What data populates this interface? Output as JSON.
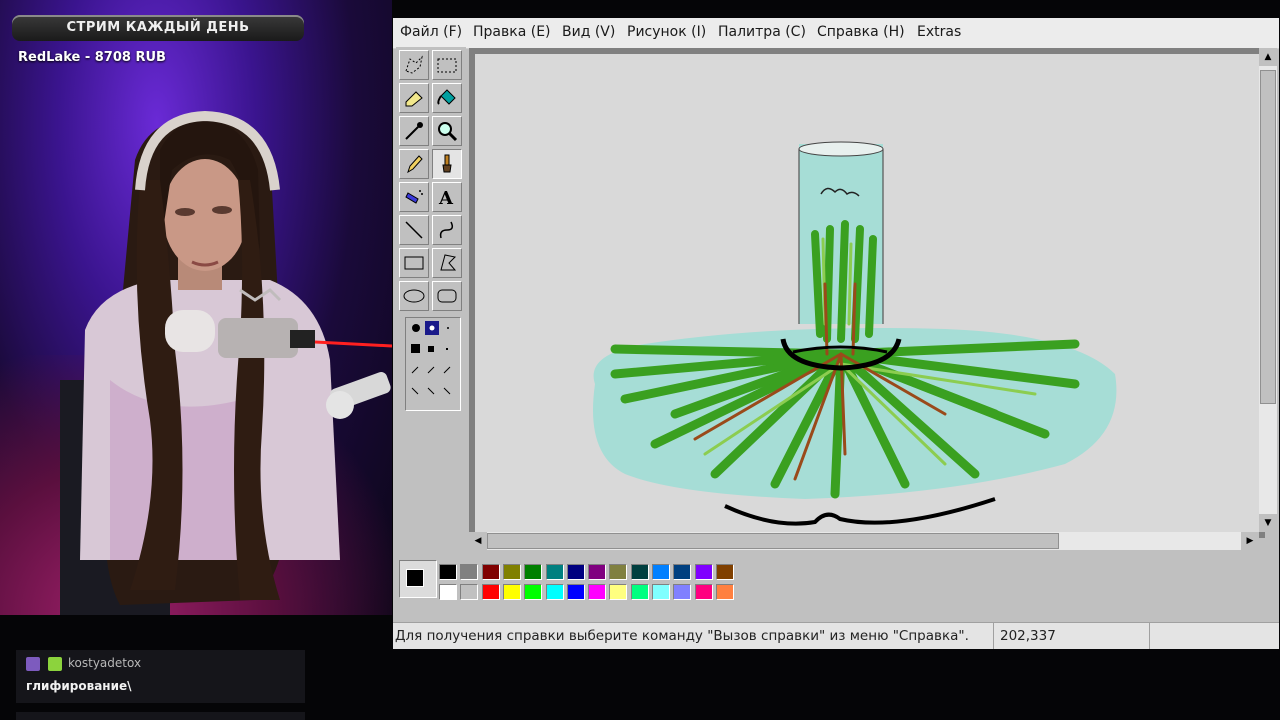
{
  "stream": {
    "alert_banner": "СТРИМ КАЖДЫЙ ДЕНЬ",
    "donation": "RedLake - 8708 RUB"
  },
  "chat": {
    "username": "kostyadetox",
    "message": "глифирование\\"
  },
  "paint": {
    "menu": [
      "Файл (F)",
      "Правка (E)",
      "Вид (V)",
      "Рисунок (I)",
      "Палитра (C)",
      "Справка (H)",
      "Extras"
    ],
    "tools": [
      {
        "name": "free-select-icon"
      },
      {
        "name": "rect-select-icon"
      },
      {
        "name": "eraser-icon"
      },
      {
        "name": "fill-icon"
      },
      {
        "name": "color-picker-icon"
      },
      {
        "name": "magnifier-icon"
      },
      {
        "name": "pencil-icon"
      },
      {
        "name": "brush-icon"
      },
      {
        "name": "airbrush-icon"
      },
      {
        "name": "text-icon",
        "label": "A"
      },
      {
        "name": "line-icon"
      },
      {
        "name": "curve-icon"
      },
      {
        "name": "rectangle-icon"
      },
      {
        "name": "polygon-icon"
      },
      {
        "name": "ellipse-icon"
      },
      {
        "name": "rounded-rect-icon"
      }
    ],
    "selected_tool": "brush-icon",
    "palette_top": [
      "#000000",
      "#808080",
      "#800000",
      "#808000",
      "#008000",
      "#008080",
      "#000080",
      "#800080",
      "#808040",
      "#004040",
      "#0080ff",
      "#004080",
      "#8000ff",
      "#804000"
    ],
    "palette_bottom": [
      "#ffffff",
      "#c0c0c0",
      "#ff0000",
      "#ffff00",
      "#00ff00",
      "#00ffff",
      "#0000ff",
      "#ff00ff",
      "#ffff80",
      "#00ff80",
      "#80ffff",
      "#8080ff",
      "#ff0080",
      "#ff8040"
    ],
    "foreground_color": "#000000",
    "background_color": "#ffffff",
    "status_text": "Для получения справки выберите команду \"Вызов справки\" из меню \"Справка\".",
    "coords": "202,337"
  }
}
